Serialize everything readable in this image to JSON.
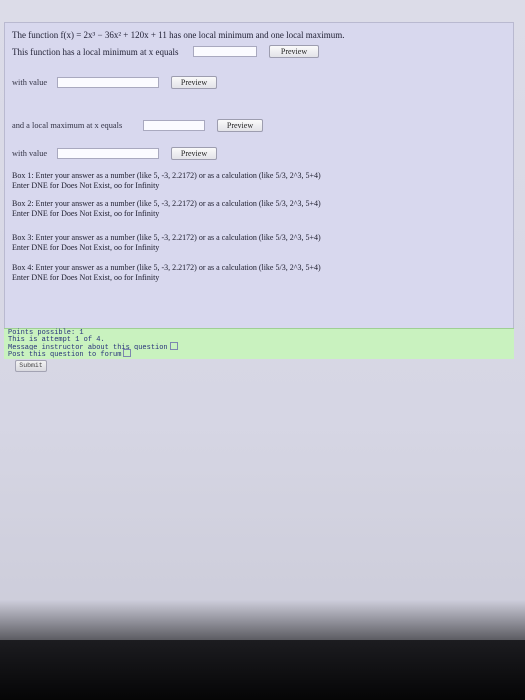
{
  "problem": {
    "statement": "The function f(x) = 2x³ − 36x² + 120x + 11 has one local minimum and one local maximum.",
    "min_prompt": "This function has a local minimum at x equals",
    "with_value_1": "with value",
    "max_prompt": "and a local maximum at x equals",
    "with_value_2": "with value",
    "preview_label": "Preview"
  },
  "hints": [
    {
      "line1": "Box 1: Enter your answer as a number (like 5, -3, 2.2172) or as a calculation (like 5/3, 2^3, 5+4)",
      "line2": "Enter DNE for Does Not Exist, oo for Infinity"
    },
    {
      "line1": "Box 2: Enter your answer as a number (like 5, -3, 2.2172) or as a calculation (like 5/3, 2^3, 5+4)",
      "line2": "Enter DNE for Does Not Exist, oo for Infinity"
    },
    {
      "line1": "Box 3: Enter your answer as a number (like 5, -3, 2.2172) or as a calculation (like 5/3, 2^3, 5+4)",
      "line2": "Enter DNE for Does Not Exist, oo for Infinity"
    },
    {
      "line1": "Box 4: Enter your answer as a number (like 5, -3, 2.2172) or as a calculation (like 5/3, 2^3, 5+4)",
      "line2": "Enter DNE for Does Not Exist, oo for Infinity"
    }
  ],
  "info": {
    "points": "Points possible: 1",
    "attempt": "This is attempt 1 of 4.",
    "message_link": "Message instructor about this question",
    "forum_link": "Post this question to forum"
  },
  "submit_label": "Submit",
  "colors": {
    "panel": "#d8d8ee",
    "info_panel": "#c9f2bf",
    "link": "#28327a"
  }
}
